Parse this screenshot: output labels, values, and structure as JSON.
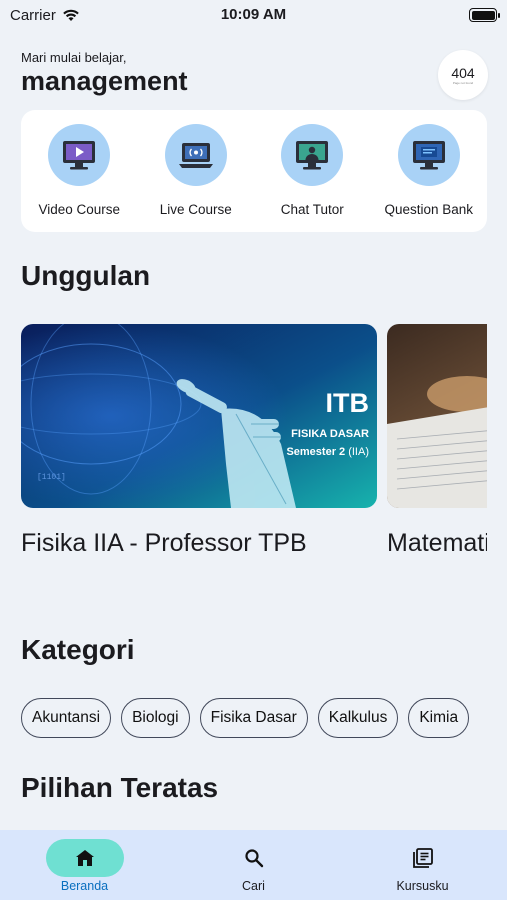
{
  "status_bar": {
    "carrier": "Carrier",
    "time": "10:09 AM"
  },
  "header": {
    "greeting": "Mari mulai belajar,",
    "username": "management",
    "avatar_code": "404",
    "avatar_subtext": "Page not found"
  },
  "quick_actions": [
    {
      "label": "Video Course",
      "icon": "video-play-monitor-icon"
    },
    {
      "label": "Live Course",
      "icon": "live-broadcast-laptop-icon"
    },
    {
      "label": "Chat Tutor",
      "icon": "tutor-monitor-icon"
    },
    {
      "label": "Question Bank",
      "icon": "question-bank-monitor-icon"
    }
  ],
  "featured": {
    "title": "Unggulan",
    "cards": [
      {
        "title": "Fisika IIA - Professor TPB",
        "banner": {
          "brand": "ITB",
          "subject": "FISIKA DASAR",
          "semester_bold": "Semester 2",
          "semester_rest": " (IIA)"
        }
      },
      {
        "title": "Matematika TPB"
      }
    ]
  },
  "categories": {
    "title": "Kategori",
    "items": [
      "Akuntansi",
      "Biologi",
      "Fisika Dasar",
      "Kalkulus",
      "Kimia"
    ]
  },
  "top_picks": {
    "title": "Pilihan Teratas"
  },
  "bottom_nav": {
    "items": [
      {
        "label": "Beranda",
        "icon": "home-icon",
        "active": true
      },
      {
        "label": "Cari",
        "icon": "search-icon",
        "active": false
      },
      {
        "label": "Kursusku",
        "icon": "my-courses-icon",
        "active": false
      }
    ]
  },
  "colors": {
    "accent": "#6fe0d2",
    "nav_bg": "#d9e6fc",
    "icon_circle": "#a9d2f6",
    "active_label": "#0a6fbf"
  }
}
